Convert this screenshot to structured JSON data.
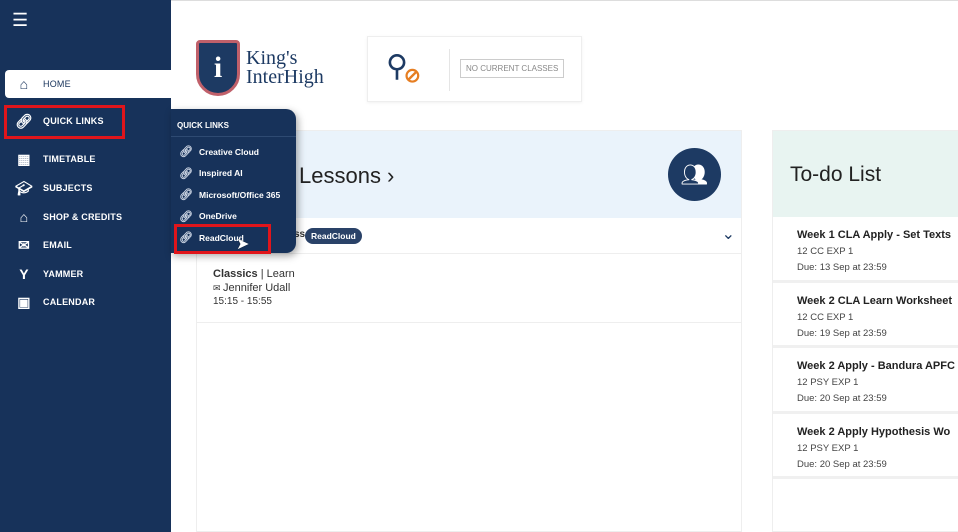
{
  "sidebar": {
    "items": [
      {
        "label": "HOME",
        "icon": "home-icon"
      },
      {
        "label": "QUICK LINKS",
        "icon": "link-icon"
      },
      {
        "label": "TIMETABLE",
        "icon": "timetable-icon"
      },
      {
        "label": "SUBJECTS",
        "icon": "graduation-cap-icon"
      },
      {
        "label": "SHOP & CREDITS",
        "icon": "basket-icon"
      },
      {
        "label": "EMAIL",
        "icon": "envelope-icon"
      },
      {
        "label": "YAMMER",
        "icon": "yammer-icon"
      },
      {
        "label": "CALENDAR",
        "icon": "calendar-icon"
      }
    ]
  },
  "quick_links": {
    "title": "QUICK LINKS",
    "items": [
      "Creative Cloud",
      "Inspired AI",
      "Microsoft/Office 365",
      "OneDrive",
      "ReadCloud"
    ]
  },
  "logo": {
    "line1": "King's",
    "line2": "InterHigh"
  },
  "classes": {
    "status": "NO CURRENT CLASSES"
  },
  "lessons": {
    "title": "Lessons ›",
    "row_partial": "ss",
    "badge": "ReadCloud",
    "items": [
      {
        "subject": "Classics",
        "type": "Learn",
        "teacher": "Jennifer Udall",
        "time": "15:15 - 15:55"
      }
    ]
  },
  "todo": {
    "title": "To-do List",
    "items": [
      {
        "title": "Week 1 CLA Apply - Set Texts",
        "group": "12 CC EXP 1",
        "due": "Due: 13 Sep at 23:59"
      },
      {
        "title": "Week 2 CLA Learn Worksheet",
        "group": "12 CC EXP 1",
        "due": "Due: 19 Sep at 23:59"
      },
      {
        "title": "Week 2 Apply - Bandura APFC",
        "group": "12 PSY EXP 1",
        "due": "Due: 20 Sep at 23:59"
      },
      {
        "title": "Week 2 Apply Hypothesis Wo",
        "group": "12 PSY EXP 1",
        "due": "Due: 20 Sep at 23:59"
      }
    ]
  },
  "colors": {
    "sidebar": "#17325a",
    "highlight": "#e0151b",
    "accent": "#e67e22"
  }
}
